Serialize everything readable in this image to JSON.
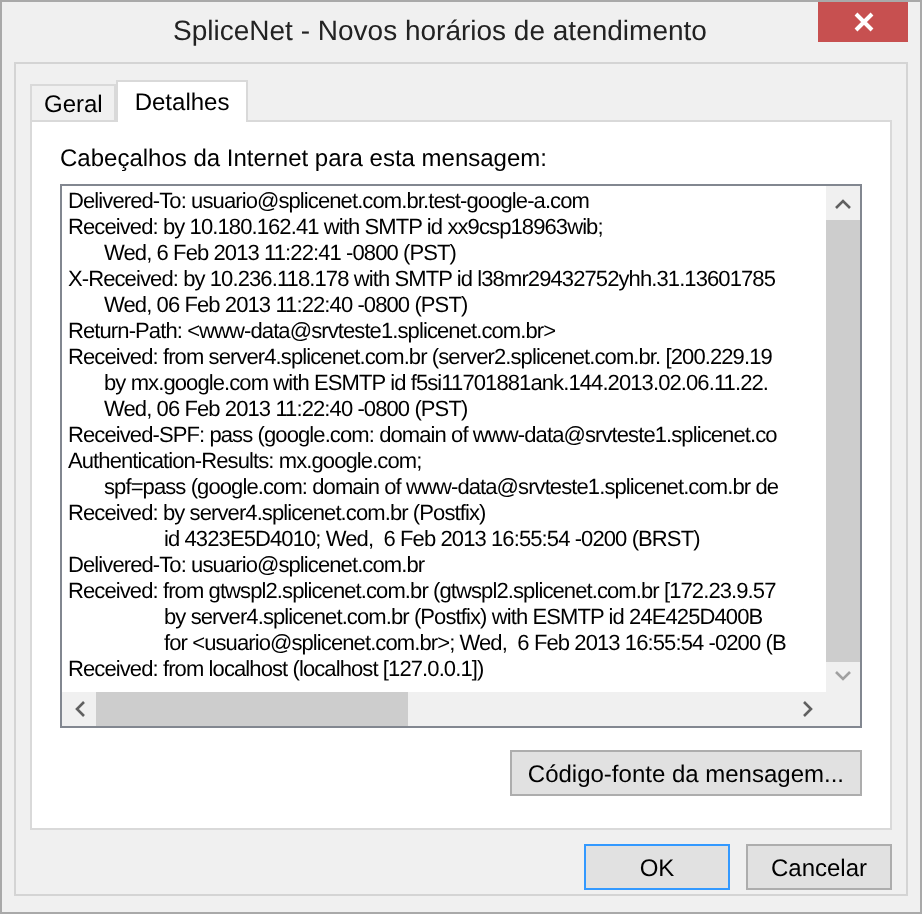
{
  "window": {
    "title": "SpliceNet - Novos horários de atendimento"
  },
  "tabs": [
    {
      "label": "Geral",
      "selected": false
    },
    {
      "label": "Detalhes",
      "selected": true
    }
  ],
  "headers": {
    "label": "Cabeçalhos da Internet para esta mensagem:",
    "lines": [
      {
        "kind": "header",
        "text": "Delivered-To: usuario@splicenet.com.br.test-google-a.com"
      },
      {
        "kind": "header",
        "text": "Received: by 10.180.162.41 with SMTP id xx9csp18963wib;"
      },
      {
        "kind": "continuation",
        "text": "Wed, 6 Feb 2013 11:22:41 -0800 (PST)"
      },
      {
        "kind": "header",
        "text": "X-Received: by 10.236.118.178 with SMTP id l38mr29432752yhh.31.13601785"
      },
      {
        "kind": "continuation",
        "text": "Wed, 06 Feb 2013 11:22:40 -0800 (PST)"
      },
      {
        "kind": "header",
        "text": "Return-Path: <www-data@srvteste1.splicenet.com.br>"
      },
      {
        "kind": "header",
        "text": "Received: from server4.splicenet.com.br (server2.splicenet.com.br. [200.229.19"
      },
      {
        "kind": "continuation",
        "text": "by mx.google.com with ESMTP id f5si11701881ank.144.2013.02.06.11.22."
      },
      {
        "kind": "continuation",
        "text": "Wed, 06 Feb 2013 11:22:40 -0800 (PST)"
      },
      {
        "kind": "header",
        "text": "Received-SPF: pass (google.com: domain of www-data@srvteste1.splicenet.co"
      },
      {
        "kind": "header",
        "text": "Authentication-Results: mx.google.com;"
      },
      {
        "kind": "continuation",
        "text": "spf=pass (google.com: domain of www-data@srvteste1.splicenet.com.br de"
      },
      {
        "kind": "header",
        "text": "Received: by server4.splicenet.com.br (Postfix)"
      },
      {
        "kind": "tabbed",
        "text": "id 4323E5D4010; Wed,  6 Feb 2013 16:55:54 -0200 (BRST)"
      },
      {
        "kind": "header",
        "text": "Delivered-To: usuario@splicenet.com.br"
      },
      {
        "kind": "header",
        "text": "Received: from gtwspl2.splicenet.com.br (gtwspl2.splicenet.com.br [172.23.9.57"
      },
      {
        "kind": "tabbed",
        "text": "by server4.splicenet.com.br (Postfix) with ESMTP id 24E425D400B"
      },
      {
        "kind": "tabbed",
        "text": "for <usuario@splicenet.com.br>; Wed,  6 Feb 2013 16:55:54 -0200 (B"
      },
      {
        "kind": "header",
        "text": "Received: from localhost (localhost [127.0.0.1])"
      }
    ]
  },
  "source_button": {
    "label": "Código-fonte da mensagem..."
  },
  "dialog_buttons": [
    {
      "label": "OK",
      "default": true
    },
    {
      "label": "Cancelar",
      "default": false
    }
  ]
}
